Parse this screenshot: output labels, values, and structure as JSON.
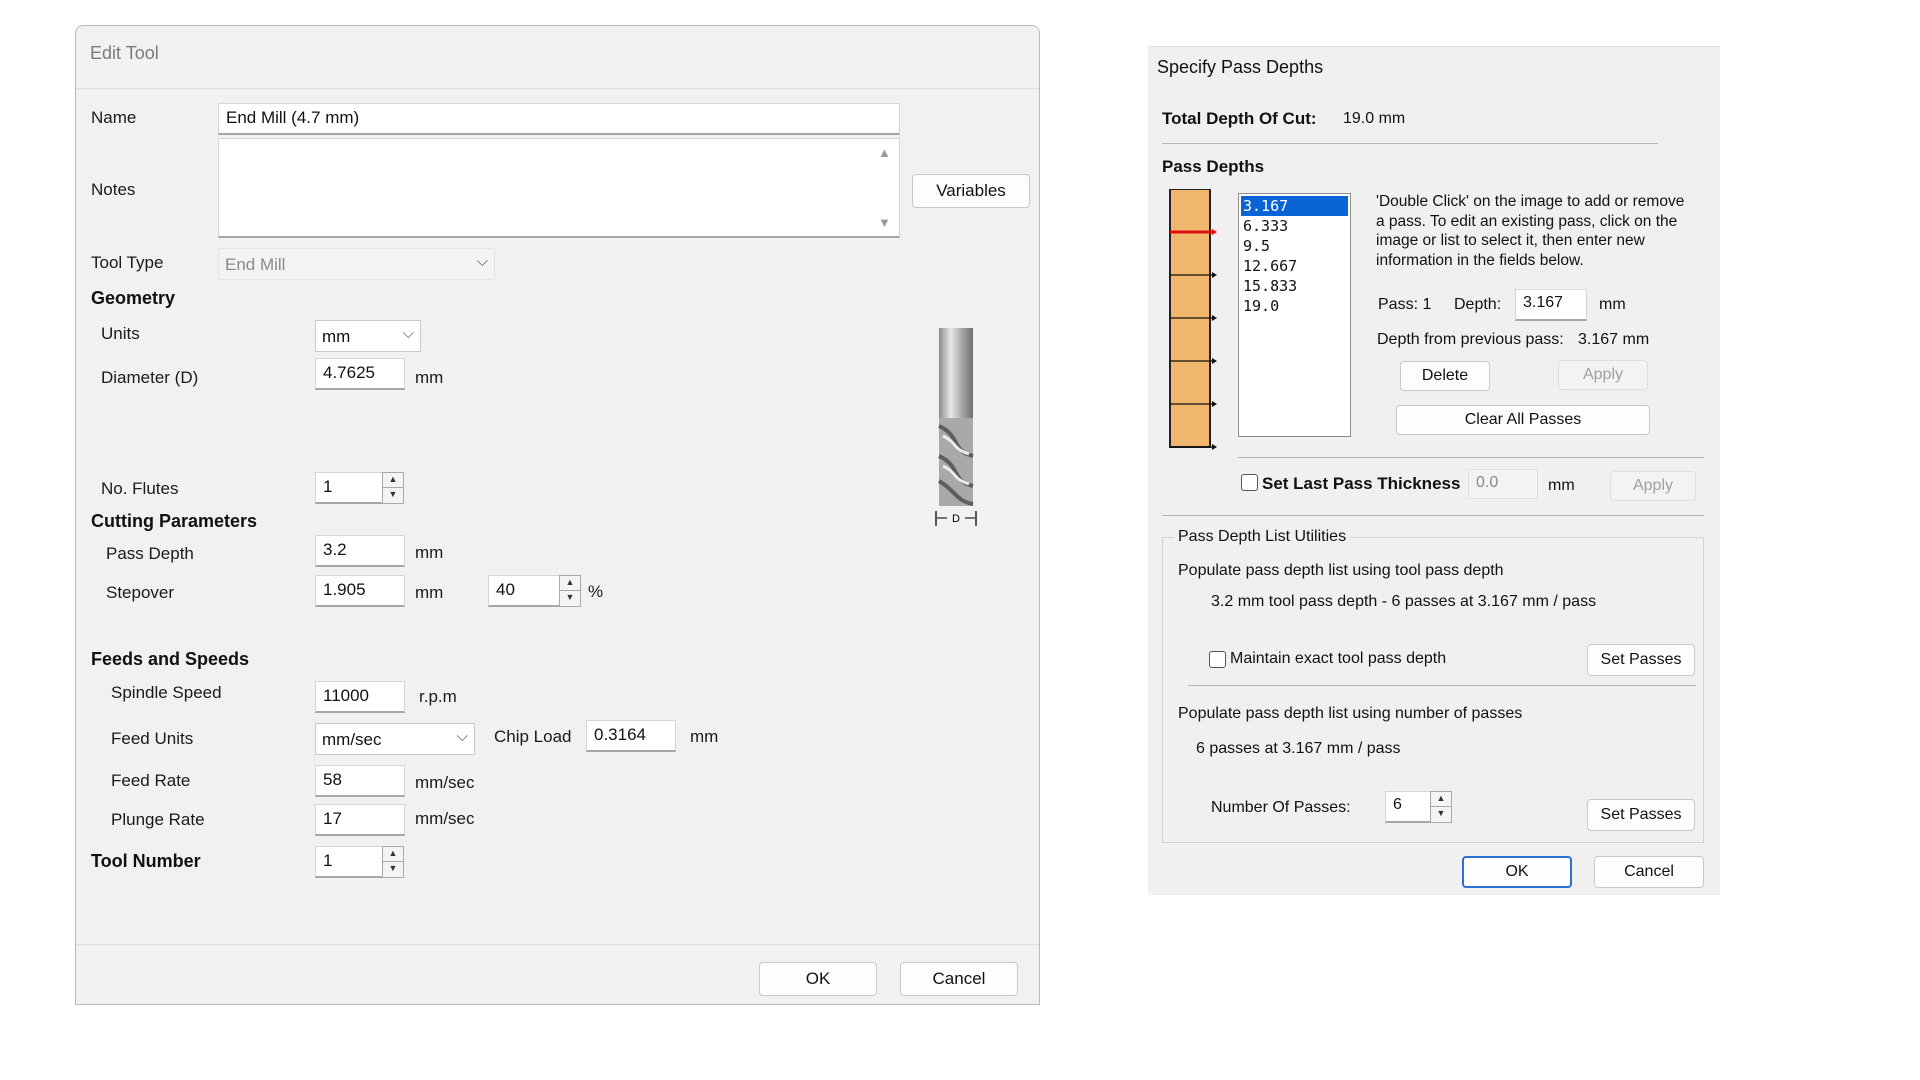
{
  "edit_tool": {
    "title": "Edit Tool",
    "name_label": "Name",
    "name_value": "End Mill (4.7 mm)",
    "notes_label": "Notes",
    "notes_value": "",
    "variables_button": "Variables",
    "tool_type_label": "Tool Type",
    "tool_type_value": "End Mill",
    "geometry": {
      "header": "Geometry",
      "units_label": "Units",
      "units_value": "mm",
      "diameter_label": "Diameter (D)",
      "diameter_value": "4.7625",
      "diameter_unit": "mm",
      "flutes_label": "No. Flutes",
      "flutes_value": "1"
    },
    "cutting": {
      "header": "Cutting Parameters",
      "pass_depth_label": "Pass Depth",
      "pass_depth_value": "3.2",
      "pass_depth_unit": "mm",
      "stepover_label": "Stepover",
      "stepover_value": "1.905",
      "stepover_unit": "mm",
      "stepover_percent": "40",
      "percent_sign": "%"
    },
    "feeds": {
      "header": "Feeds and Speeds",
      "spindle_label": "Spindle Speed",
      "spindle_value": "11000",
      "spindle_unit": "r.p.m",
      "feed_units_label": "Feed Units",
      "feed_units_value": "mm/sec",
      "chip_load_label": "Chip Load",
      "chip_load_value": "0.3164",
      "chip_load_unit": "mm",
      "feed_rate_label": "Feed Rate",
      "feed_rate_value": "58",
      "feed_rate_unit": "mm/sec",
      "plunge_label": "Plunge Rate",
      "plunge_value": "17",
      "plunge_unit": "mm/sec"
    },
    "tool_number_label": "Tool Number",
    "tool_number_value": "1",
    "diagram_label": "D",
    "ok": "OK",
    "cancel": "Cancel"
  },
  "pass_depths": {
    "title": "Specify Pass Depths",
    "total_label": "Total Depth Of Cut:",
    "total_value": "19.0 mm",
    "pass_depths_header": "Pass Depths",
    "passes": [
      "3.167",
      "6.333",
      "9.5",
      "12.667",
      "15.833",
      "19.0"
    ],
    "selected_index": 0,
    "instructions": "'Double Click' on the image to add or remove a pass. To edit an existing pass, click on the image or list to select it, then enter new information in the fields below.",
    "pass_label": "Pass: 1",
    "depth_label": "Depth:",
    "depth_value": "3.167",
    "depth_unit": "mm",
    "from_prev_label": "Depth from previous pass:",
    "from_prev_value": "3.167 mm",
    "delete": "Delete",
    "apply": "Apply",
    "clear_all": "Clear All Passes",
    "set_last_label": "Set Last Pass Thickness",
    "set_last_value": "0.0",
    "set_last_unit": "mm",
    "set_last_apply": "Apply",
    "utilities_header": "Pass Depth List Utilities",
    "populate_tool_label": "Populate pass depth list using tool pass depth",
    "populate_tool_info": "3.2 mm tool pass depth - 6 passes at 3.167 mm / pass",
    "maintain_label": "Maintain exact tool pass depth",
    "set_passes": "Set Passes",
    "populate_num_label": "Populate pass depth list using number of passes",
    "populate_num_info": "6 passes at 3.167 mm / pass",
    "num_passes_label": "Number Of Passes:",
    "num_passes_value": "6",
    "ok": "OK",
    "cancel": "Cancel"
  }
}
